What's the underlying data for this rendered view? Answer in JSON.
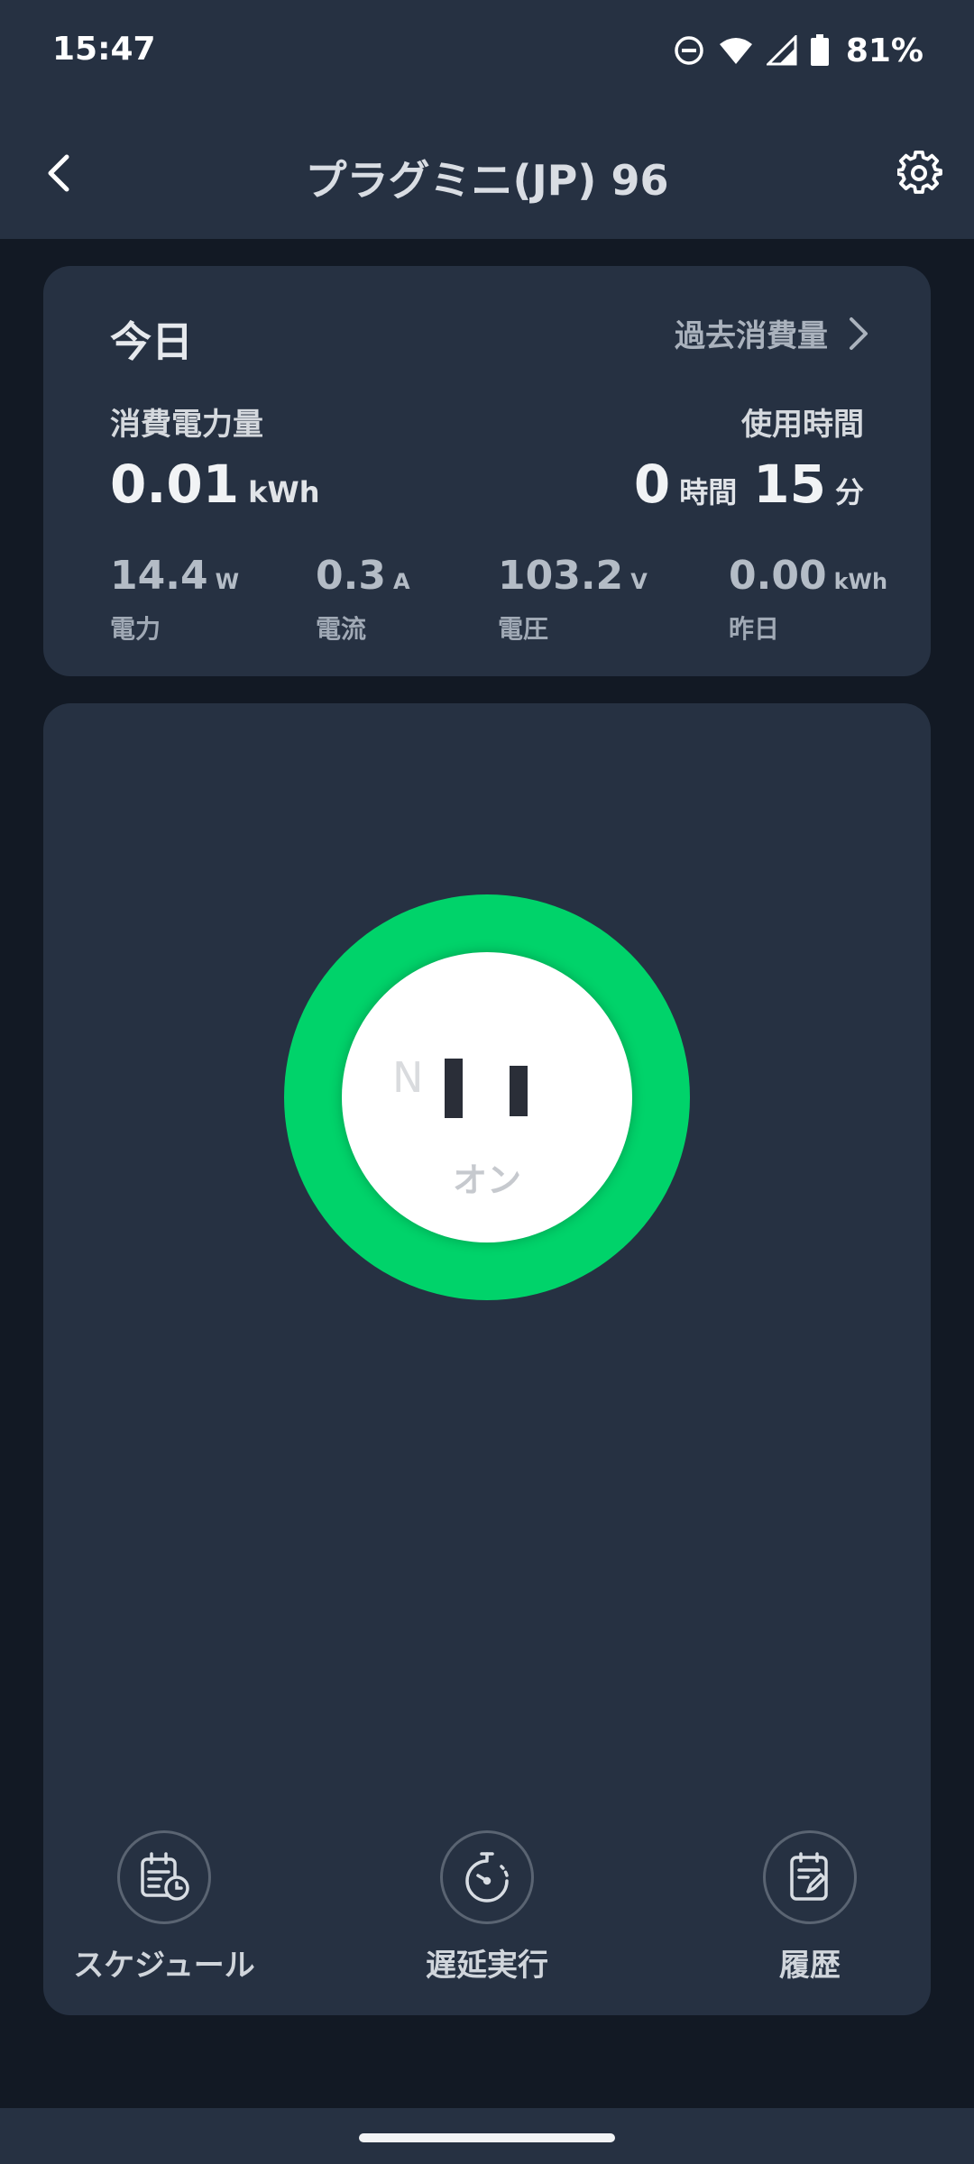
{
  "status_bar": {
    "time": "15:47",
    "battery": "81%",
    "icons": [
      "dnd-icon",
      "wifi-icon",
      "signal-icon",
      "battery-icon"
    ]
  },
  "header": {
    "title": "プラグミニ(JP) 96",
    "back_icon": "chevron-left-icon",
    "settings_icon": "gear-icon"
  },
  "today": {
    "title": "今日",
    "history_link": "過去消費量",
    "energy_label": "消費電力量",
    "energy_value": "0.01",
    "energy_unit": "kWh",
    "usage_label": "使用時間",
    "usage_hours": "0",
    "usage_hours_unit": "時間",
    "usage_minutes": "15",
    "usage_minutes_unit": "分",
    "metrics": [
      {
        "value": "14.4",
        "unit": "W",
        "label": "電力"
      },
      {
        "value": "0.3",
        "unit": "A",
        "label": "電流"
      },
      {
        "value": "103.2",
        "unit": "V",
        "label": "電圧"
      },
      {
        "value": "0.00",
        "unit": "kWh",
        "label": "昨日"
      }
    ]
  },
  "power": {
    "socket_letter": "N",
    "state_label": "オン",
    "ring_color": "#00d36a"
  },
  "actions": [
    {
      "label": "スケジュール",
      "icon": "calendar-clock-icon"
    },
    {
      "label": "遅延実行",
      "icon": "stopwatch-icon"
    },
    {
      "label": "履歴",
      "icon": "history-note-icon"
    }
  ],
  "colors": {
    "background": "#121924",
    "card": "#263142",
    "accent_green": "#00d36a"
  }
}
